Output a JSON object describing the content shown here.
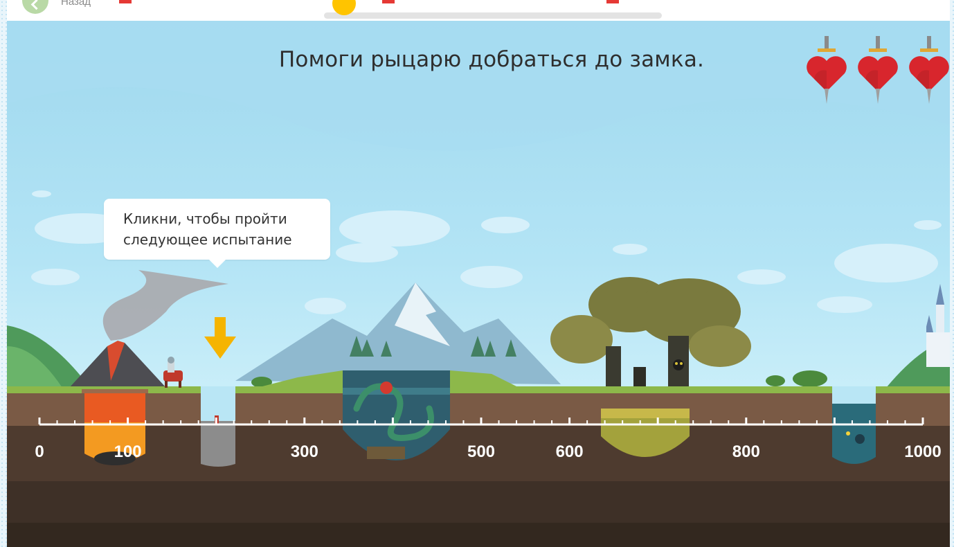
{
  "topbar": {
    "back_label": "Назад"
  },
  "game": {
    "title": "Помоги рыцарю добраться до замка.",
    "hint": {
      "line1": "Кликни, чтобы пройти",
      "line2": "следующее испытание"
    },
    "lives": [
      {
        "icon": "heart-with-sword-icon"
      },
      {
        "icon": "heart-with-sword-icon"
      },
      {
        "icon": "heart-with-sword-icon"
      }
    ],
    "ruler": {
      "labels": [
        "0",
        "100",
        "300",
        "500",
        "600",
        "800",
        "1000"
      ],
      "values": [
        0,
        100,
        300,
        500,
        600,
        800,
        1000
      ]
    },
    "stages": [
      {
        "name": "volcano",
        "icon": "volcano-icon"
      },
      {
        "name": "pit",
        "icon": "pit-icon"
      },
      {
        "name": "lake-dragon",
        "icon": "water-dragon-icon"
      },
      {
        "name": "forest",
        "icon": "dark-forest-icon"
      },
      {
        "name": "well",
        "icon": "anglerfish-icon"
      }
    ],
    "colors": {
      "sky": "#a9def2",
      "grass": "#8db84a",
      "soil": "#7a5a45",
      "underground": "#4e3b2f",
      "ruler_text": "#ffffff",
      "arrow": "#f5b400",
      "heart": "#d8262d"
    }
  }
}
